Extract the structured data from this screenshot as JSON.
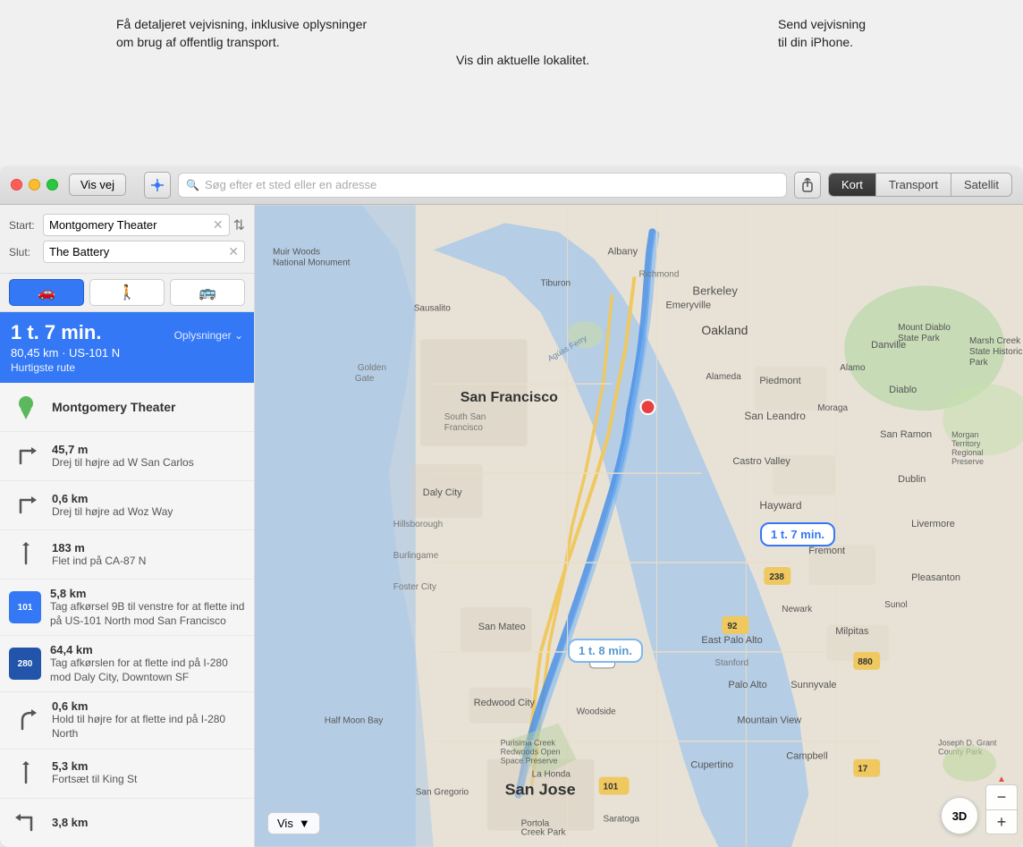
{
  "annotations": {
    "left": "Få detaljeret vejvisning, inklusive oplysninger\nom brug af offentlig transport.",
    "center": "Vis din aktuelle lokalitet.",
    "right": "Send vejvisning\ntil din iPhone."
  },
  "titlebar": {
    "vis_vej_label": "Vis vej"
  },
  "toolbar": {
    "search_placeholder": "Søg efter et sted eller en adresse"
  },
  "map_tabs": [
    {
      "label": "Kort",
      "active": true
    },
    {
      "label": "Transport",
      "active": false
    },
    {
      "label": "Satellit",
      "active": false
    }
  ],
  "route": {
    "start_label": "Start:",
    "end_label": "Slut:",
    "start_value": "Montgomery Theater",
    "end_value": "The Battery",
    "time": "1 t. 7 min.",
    "info_link": "Oplysninger ⌄",
    "details": "80,45 km · US-101 N",
    "route_type": "Hurtigste rute"
  },
  "transport_modes": [
    {
      "icon": "🚗",
      "label": "drive",
      "active": true
    },
    {
      "icon": "🚶",
      "label": "walk",
      "active": false
    },
    {
      "icon": "🚌",
      "label": "transit",
      "active": false
    }
  ],
  "directions": [
    {
      "type": "start-pin",
      "dist": "Montgomery Theater",
      "desc": ""
    },
    {
      "type": "turn-right",
      "dist": "45,7 m",
      "desc": "Drej til højre ad W San Carlos"
    },
    {
      "type": "turn-right",
      "dist": "0,6 km",
      "desc": "Drej til højre ad Woz Way"
    },
    {
      "type": "merge",
      "dist": "183 m",
      "desc": "Flet ind på CA-87 N"
    },
    {
      "type": "highway-101",
      "dist": "5,8 km",
      "desc": "Tag afkørsel 9B til venstre for at flette ind på US-101 North mod San Francisco"
    },
    {
      "type": "highway-280",
      "dist": "64,4 km",
      "desc": "Tag afkørslen for at flette ind på I-280 mod Daly City, Downtown SF"
    },
    {
      "type": "turn-right",
      "dist": "0,6 km",
      "desc": "Hold til højre for at flette ind på I-280 North"
    },
    {
      "type": "straight",
      "dist": "5,3 km",
      "desc": "Fortsæt til King St"
    },
    {
      "type": "turn-left",
      "dist": "3,8 km",
      "desc": ""
    }
  ],
  "map": {
    "route_bubble_1": "1 t. 7 min.",
    "route_bubble_2": "1 t. 8 min.",
    "vis_dropdown": "Vis",
    "label_3d": "3D",
    "zoom_plus": "+",
    "zoom_minus": "−",
    "compass_label": "▲",
    "locations": {
      "mount_diablo": "Mount Diablo State Park",
      "marsh_creek": "Marsh Creek State Historic Park"
    }
  }
}
